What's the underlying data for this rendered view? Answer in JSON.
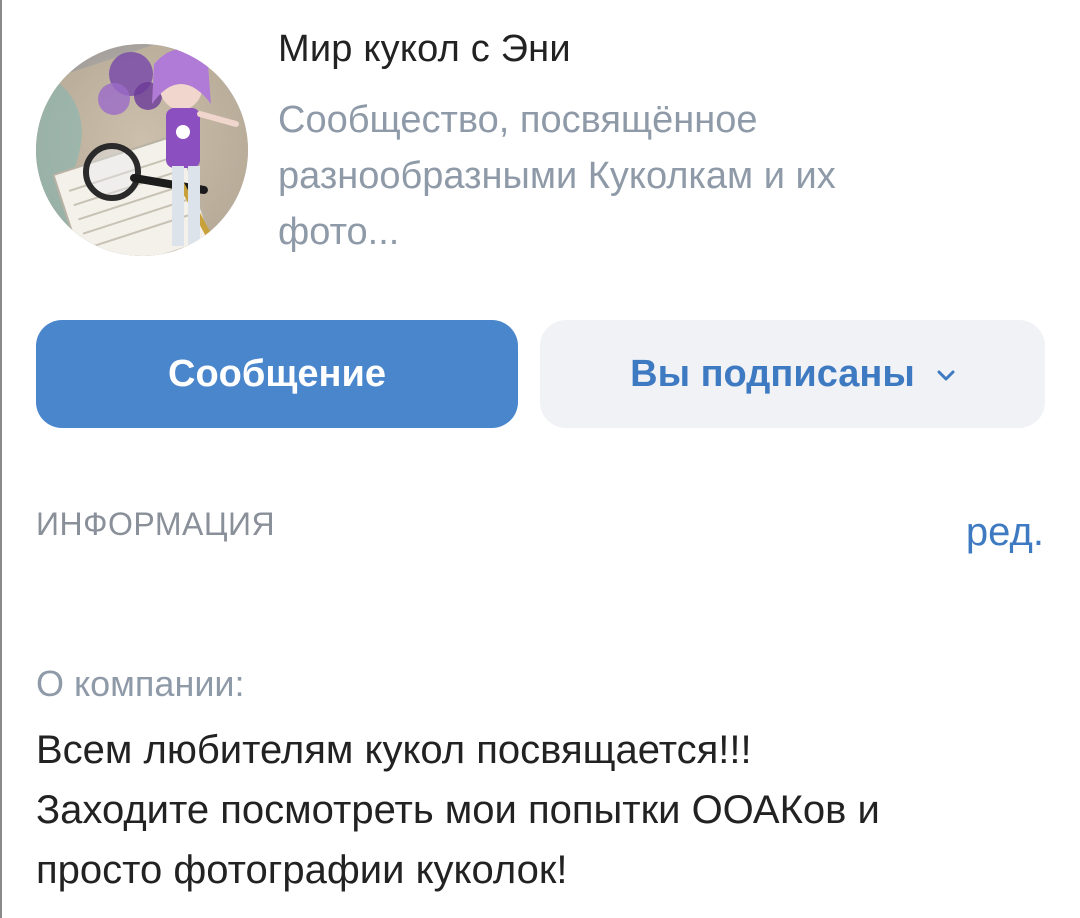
{
  "community": {
    "name": "Мир кукол с Эни",
    "description_lines": [
      "Сообщество, посвящённое",
      "разнообразными Куколкам и их",
      "фото..."
    ]
  },
  "actions": {
    "message_label": "Сообщение",
    "subscribed_label": "Вы подписаны",
    "subscribed_icon": "chevron-down-icon"
  },
  "info": {
    "section_title": "ИНФОРМАЦИЯ",
    "edit_label": "ред.",
    "about_label": "О компании:",
    "about_lines": [
      "Всем любителям кукол посвящается!!!",
      "Заходите посмотреть мои попытки ООАКов и",
      "просто фотографии куколок!"
    ]
  },
  "colors": {
    "accent": "#4a86cc",
    "link": "#3e7ac2",
    "muted": "#8f9aa8",
    "secondary_button_bg": "#f0f2f5"
  }
}
